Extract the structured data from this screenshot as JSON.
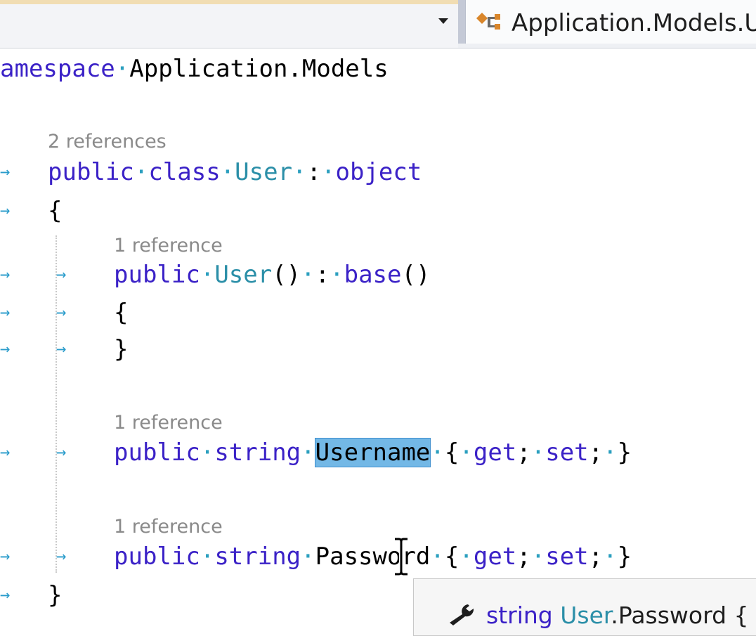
{
  "navbar": {
    "right_label": "Application.Models.U"
  },
  "code": {
    "namespace_kw": "amespace",
    "namespace_name": "Application.Models",
    "class_refs": "2 references",
    "ctor_refs": "1 reference",
    "username_refs": "1 reference",
    "password_refs": "1 reference",
    "kw_public": "public",
    "kw_class": "class",
    "kw_object": "object",
    "kw_base": "base",
    "kw_string": "string",
    "kw_get": "get",
    "kw_set": "set",
    "class_name": "User",
    "username_prop": "Username",
    "password_prop": "Password"
  },
  "tooltip": {
    "kw": "string",
    "type": "User",
    "rest": ".Password { "
  },
  "colors": {
    "keyword": "#3b22c7",
    "type": "#2b8fa8",
    "selection": "#73b8e6",
    "lens": "#8a8a8a"
  }
}
